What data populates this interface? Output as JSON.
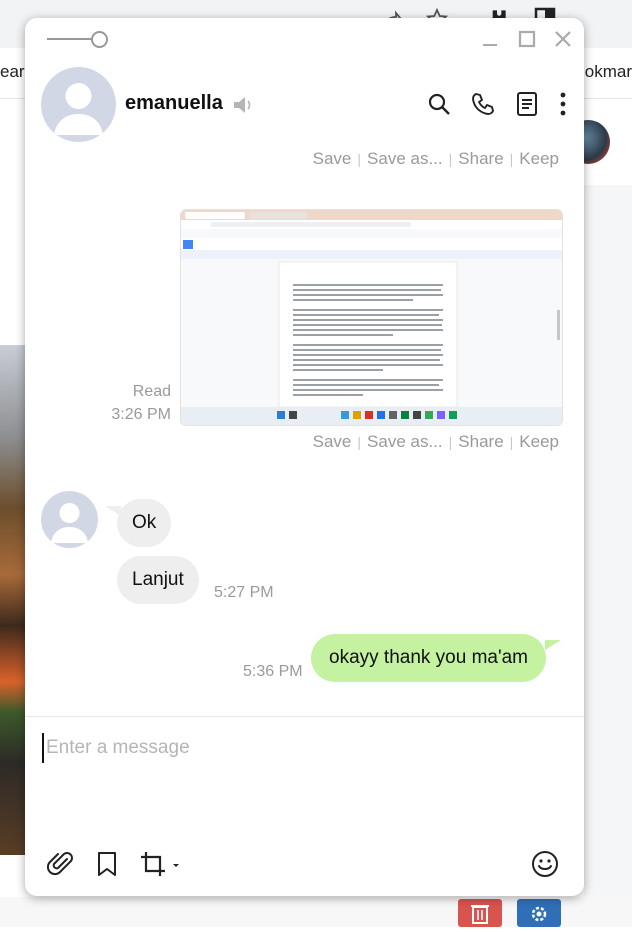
{
  "background": {
    "left_text": "earn",
    "right_text": "okmar"
  },
  "header": {
    "contact_name": "emanuella"
  },
  "messages": {
    "file_actions": [
      "Save",
      "Save as...",
      "Share",
      "Keep"
    ],
    "read_label": "Read",
    "image_time": "3:26 PM",
    "incoming": [
      "Ok",
      "Lanjut"
    ],
    "incoming_time": "5:27 PM",
    "outgoing_text": "okayy thank you ma'am",
    "outgoing_time": "5:36 PM"
  },
  "composer": {
    "placeholder": "Enter a message"
  },
  "colors": {
    "outgoing_bubble": "#c4f2a0",
    "incoming_bubble": "#eeeeee",
    "avatar": "#d2d7e6",
    "delete_button": "#d9534f",
    "settings_button": "#2f6fb7"
  },
  "icons": [
    "speaker-icon",
    "search-icon",
    "phone-icon",
    "notes-icon",
    "more-icon",
    "minimize-icon",
    "maximize-icon",
    "close-icon",
    "attach-icon",
    "bookmark-icon",
    "capture-icon",
    "emoji-icon"
  ]
}
